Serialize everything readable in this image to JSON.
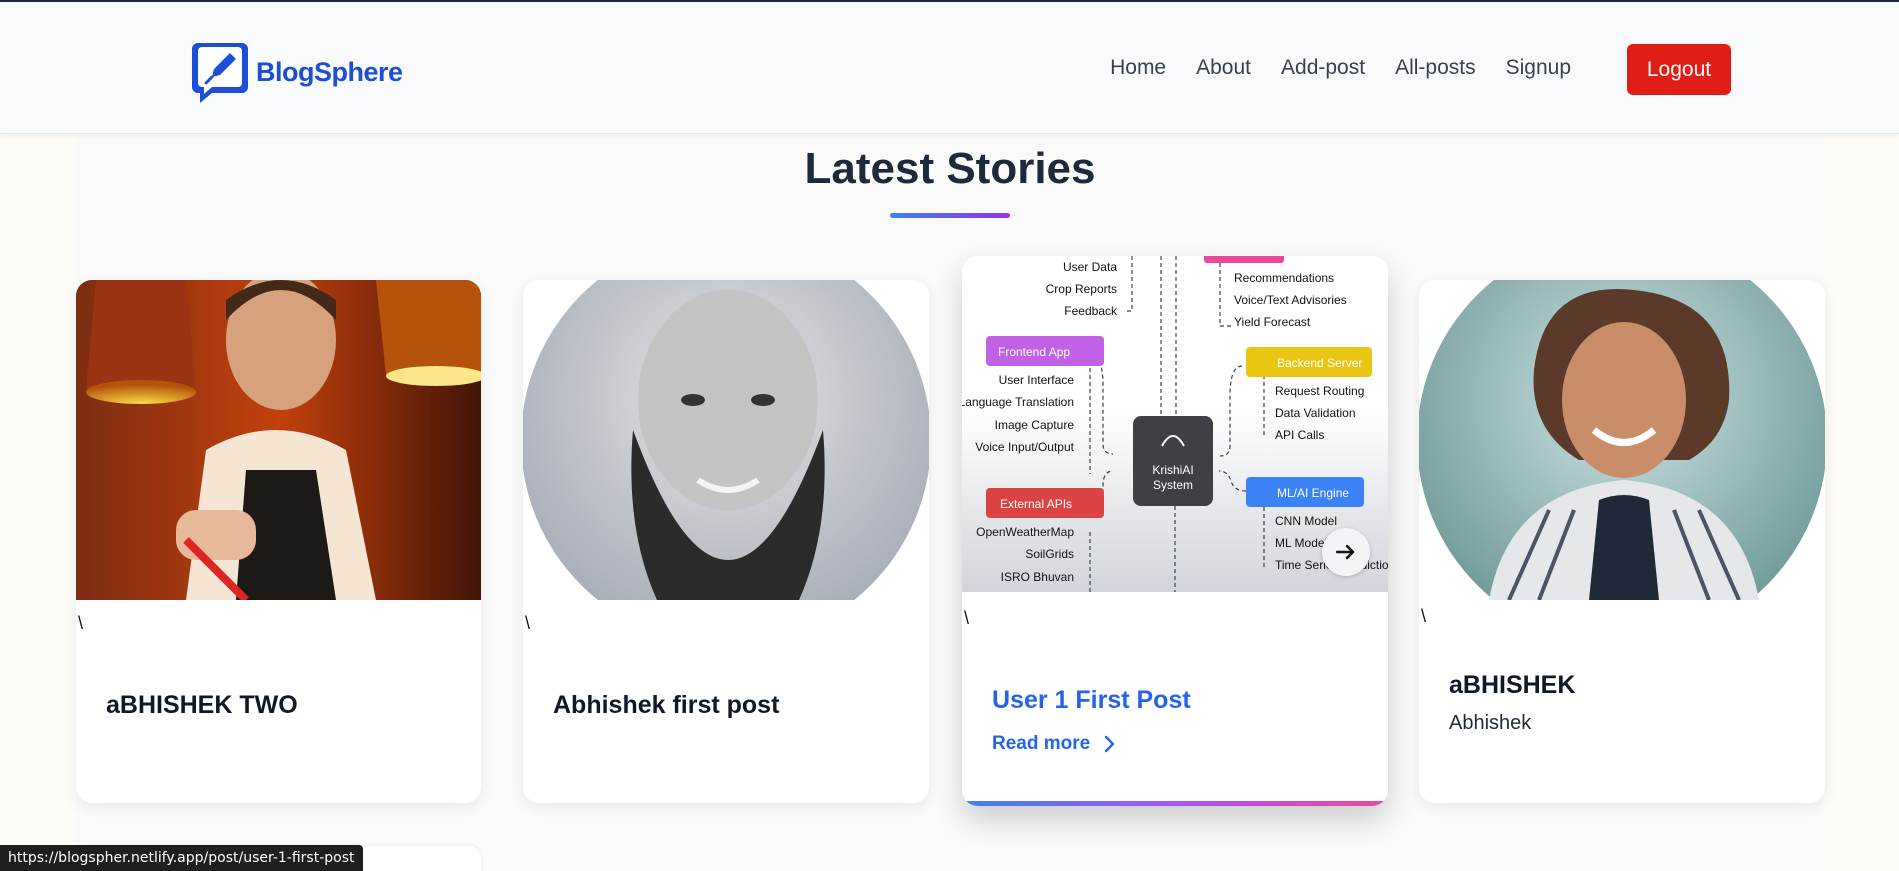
{
  "brand": {
    "name": "BlogSphere"
  },
  "nav": {
    "links": [
      "Home",
      "About",
      "Add-post",
      "All-posts",
      "Signup"
    ],
    "logout_label": "Logout"
  },
  "section": {
    "title": "Latest Stories"
  },
  "cards": [
    {
      "slash": "\\",
      "title": "aBHISHEK TWO",
      "subtitle": "",
      "image": "chef-photo"
    },
    {
      "slash": "\\",
      "title": "Abhishek first post",
      "subtitle": "",
      "image": "bearded-man-portrait"
    },
    {
      "slash": "\\",
      "title": "User 1 First Post",
      "subtitle": "",
      "read_more": "Read more",
      "image": "krishiai-system-diagram"
    },
    {
      "slash": "\\",
      "title": "aBHISHEK",
      "subtitle": "Abhishek",
      "image": "woman-portrait"
    }
  ],
  "diagram": {
    "center": [
      "KrishiAI",
      "System"
    ],
    "top_left_items": [
      "User Data",
      "Crop Reports",
      "Feedback"
    ],
    "top_right_items": [
      "Recommendations",
      "Voice/Text Advisories",
      "Yield Forecast"
    ],
    "frontend": {
      "label": "Frontend App",
      "items": [
        "User Interface",
        "Language Translation",
        "Image Capture",
        "Voice Input/Output"
      ]
    },
    "backend": {
      "label": "Backend Server",
      "items": [
        "Request Routing",
        "Data Validation",
        "API Calls"
      ]
    },
    "external": {
      "label": "External APIs",
      "items": [
        "OpenWeatherMap",
        "SoilGrids",
        "ISRO Bhuvan"
      ]
    },
    "ml": {
      "label": "ML/AI Engine",
      "items": [
        "CNN Model",
        "ML Model",
        "Time Series Prediction"
      ]
    }
  },
  "status_bar": {
    "url": "https://blogspher.netlify.app/post/user-1-first-post"
  },
  "colors": {
    "brand": "#1d4ed8",
    "logout": "#e11d17",
    "link": "#2563eb",
    "accent_start": "#3b82f6",
    "accent_end": "#9333ea"
  }
}
